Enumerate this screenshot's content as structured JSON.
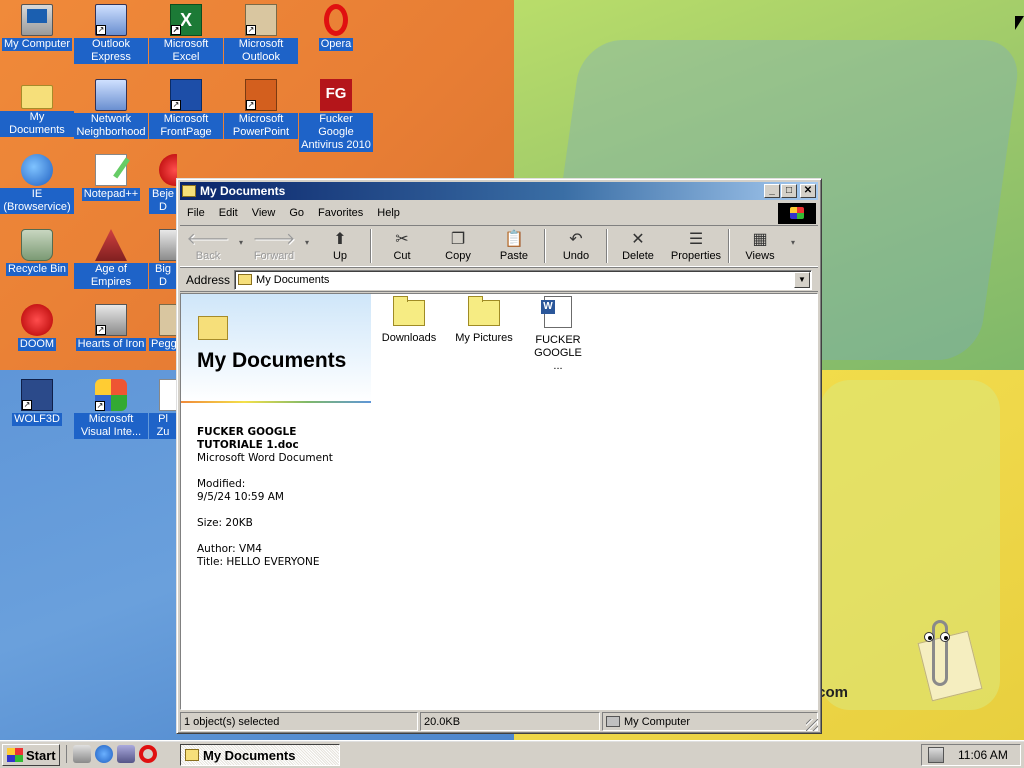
{
  "desktop": {
    "icons": [
      {
        "label": "My Computer"
      },
      {
        "label": "Outlook Express"
      },
      {
        "label": "Microsoft Excel"
      },
      {
        "label": "Microsoft Outlook"
      },
      {
        "label": "Opera"
      },
      {
        "label": "My Documents"
      },
      {
        "label": "Network Neighborhood"
      },
      {
        "label": "Microsoft FrontPage"
      },
      {
        "label": "Microsoft PowerPoint"
      },
      {
        "label": "Fucker Google Antivirus 2010"
      },
      {
        "label": "IE (Browservice)"
      },
      {
        "label": "Notepad++"
      },
      {
        "label": "Beje D"
      },
      {
        "label": "Recycle Bin"
      },
      {
        "label": "Age of Empires"
      },
      {
        "label": "Big D"
      },
      {
        "label": "DOOM"
      },
      {
        "label": "Hearts of Iron"
      },
      {
        "label": "Pegg"
      },
      {
        "label": "WOLF3D"
      },
      {
        "label": "Microsoft Visual Inte..."
      },
      {
        "label": "Pl Zu"
      }
    ],
    "wallpaper_text": "t.com"
  },
  "window": {
    "title": "My Documents",
    "controls": {
      "minimize": "_",
      "maximize": "□",
      "close": "✕"
    },
    "menu": [
      "File",
      "Edit",
      "View",
      "Go",
      "Favorites",
      "Help"
    ],
    "toolbar": {
      "back": "Back",
      "forward": "Forward",
      "up": "Up",
      "cut": "Cut",
      "copy": "Copy",
      "paste": "Paste",
      "undo": "Undo",
      "delete": "Delete",
      "properties": "Properties",
      "views": "Views"
    },
    "address": {
      "label": "Address",
      "value": "My Documents"
    },
    "banner_title": "My Documents",
    "details": {
      "name": "FUCKER GOOGLE TUTORIALE 1.doc",
      "type": "Microsoft Word Document",
      "modified_label": "Modified:",
      "modified_value": "9/5/24 10:59 AM",
      "size": "Size: 20KB",
      "author": "Author: VM4",
      "title": "Title: HELLO EVERYONE"
    },
    "files": [
      {
        "label": "Downloads",
        "kind": "folder"
      },
      {
        "label": "My Pictures",
        "kind": "folder"
      },
      {
        "label": "FUCKER GOOGLE ...",
        "kind": "word-doc"
      }
    ],
    "status": {
      "selection": "1 object(s) selected",
      "size": "20.0KB",
      "zone": "My Computer"
    }
  },
  "taskbar": {
    "start": "Start",
    "task": "My Documents",
    "clock": "11:06 AM"
  }
}
